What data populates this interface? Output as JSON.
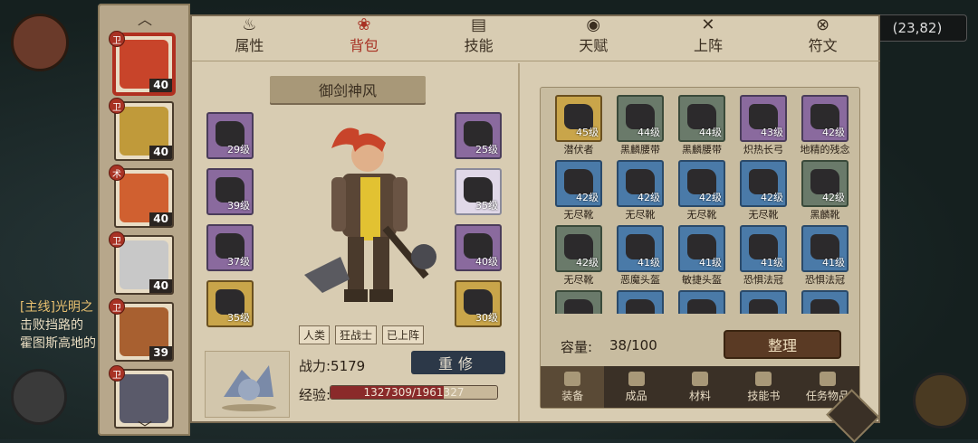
{
  "background": {
    "coords": "(23,82)",
    "quest_title": "[主线]光明之",
    "quest_line1": "击败挡路的",
    "quest_line2": "霍图斯高地的"
  },
  "tabs": [
    {
      "label": "属性",
      "icon": "attribute-icon"
    },
    {
      "label": "背包",
      "icon": "backpack-icon"
    },
    {
      "label": "技能",
      "icon": "skill-book-icon"
    },
    {
      "label": "天赋",
      "icon": "talent-eye-icon"
    },
    {
      "label": "上阵",
      "icon": "crossed-swords-icon"
    },
    {
      "label": "符文",
      "icon": "rune-icon"
    }
  ],
  "roster": [
    {
      "level": "40",
      "badge": "卫",
      "color": "#c8442a"
    },
    {
      "level": "40",
      "badge": "卫",
      "color": "#c09a3a"
    },
    {
      "level": "40",
      "badge": "术",
      "color": "#d06030"
    },
    {
      "level": "40",
      "badge": "卫",
      "color": "#c8c8c8"
    },
    {
      "level": "39",
      "badge": "卫",
      "color": "#a86030"
    },
    {
      "level": "",
      "badge": "卫",
      "color": "#5a5a6a"
    }
  ],
  "hero": {
    "name": "御剑神风",
    "tags": [
      "人类",
      "狂战士",
      "已上阵"
    ],
    "power_label": "战力:5179",
    "reforge_label": "重修",
    "exp_label": "经验:",
    "exp_text": "1327309/1961327",
    "exp_fraction": 0.677
  },
  "equipment": [
    {
      "lvl": "29级",
      "quality": "purple"
    },
    {
      "lvl": "39级",
      "quality": "purple"
    },
    {
      "lvl": "37级",
      "quality": "purple"
    },
    {
      "lvl": "35级",
      "quality": "gold"
    },
    {
      "lvl": "25级",
      "quality": "purple"
    },
    {
      "lvl": "35级",
      "quality": "white"
    },
    {
      "lvl": "40级",
      "quality": "purple"
    },
    {
      "lvl": "30级",
      "quality": "gold"
    }
  ],
  "inventory": {
    "items": [
      {
        "name": "潜伏者",
        "lvl": "45级",
        "quality": "gold"
      },
      {
        "name": "黑麟腰带",
        "lvl": "44级",
        "quality": "green"
      },
      {
        "name": "黑麟腰带",
        "lvl": "44级",
        "quality": "green"
      },
      {
        "name": "炽热长弓",
        "lvl": "43级",
        "quality": "purple"
      },
      {
        "name": "地精的残念",
        "lvl": "42级",
        "quality": "purple"
      },
      {
        "name": "无尽靴",
        "lvl": "42级",
        "quality": "blue"
      },
      {
        "name": "无尽靴",
        "lvl": "42级",
        "quality": "blue"
      },
      {
        "name": "无尽靴",
        "lvl": "42级",
        "quality": "blue"
      },
      {
        "name": "无尽靴",
        "lvl": "42级",
        "quality": "blue"
      },
      {
        "name": "黑麟靴",
        "lvl": "42级",
        "quality": "green"
      },
      {
        "name": "无尽靴",
        "lvl": "42级",
        "quality": "green"
      },
      {
        "name": "恶魔头盔",
        "lvl": "41级",
        "quality": "blue"
      },
      {
        "name": "敏捷头盔",
        "lvl": "41级",
        "quality": "blue"
      },
      {
        "name": "恐惧法冠",
        "lvl": "41级",
        "quality": "blue"
      },
      {
        "name": "恐惧法冠",
        "lvl": "41级",
        "quality": "blue"
      },
      {
        "name": "",
        "lvl": "",
        "quality": "green"
      },
      {
        "name": "",
        "lvl": "",
        "quality": "blue"
      },
      {
        "name": "",
        "lvl": "",
        "quality": "blue"
      },
      {
        "name": "",
        "lvl": "",
        "quality": "blue"
      },
      {
        "name": "",
        "lvl": "",
        "quality": "blue"
      }
    ],
    "capacity_label": "容量:",
    "capacity_value": "38/100",
    "sort_label": "整理",
    "tabs": [
      "装备",
      "成品",
      "材料",
      "技能书",
      "任务物品"
    ]
  }
}
